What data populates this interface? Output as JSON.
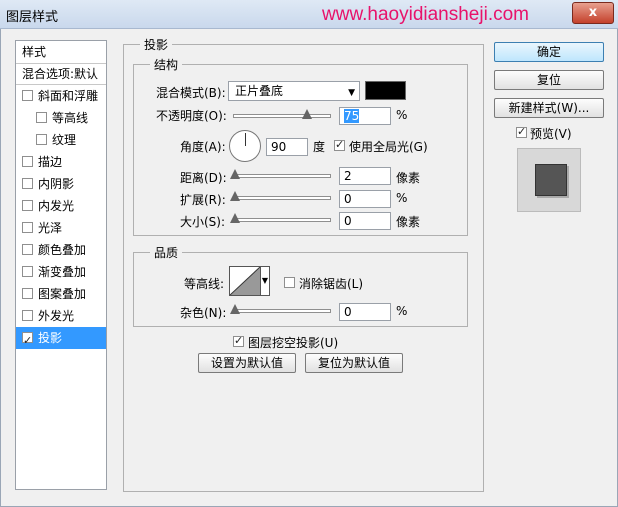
{
  "window": {
    "title": "图层样式",
    "watermark": "www.haoyidiansheji.com",
    "close_label": "x"
  },
  "styles_panel": {
    "header": "样式",
    "blend_options": "混合选项:默认",
    "items": [
      {
        "label": "斜面和浮雕",
        "checked": false,
        "indent": false
      },
      {
        "label": "等高线",
        "checked": false,
        "indent": true
      },
      {
        "label": "纹理",
        "checked": false,
        "indent": true
      },
      {
        "label": "描边",
        "checked": false,
        "indent": false
      },
      {
        "label": "内阴影",
        "checked": false,
        "indent": false
      },
      {
        "label": "内发光",
        "checked": false,
        "indent": false
      },
      {
        "label": "光泽",
        "checked": false,
        "indent": false
      },
      {
        "label": "颜色叠加",
        "checked": false,
        "indent": false
      },
      {
        "label": "渐变叠加",
        "checked": false,
        "indent": false
      },
      {
        "label": "图案叠加",
        "checked": false,
        "indent": false
      },
      {
        "label": "外发光",
        "checked": false,
        "indent": false
      },
      {
        "label": "投影",
        "checked": true,
        "indent": false,
        "selected": true
      }
    ]
  },
  "drop_shadow": {
    "title": "投影",
    "structure": {
      "title": "结构",
      "blend_mode_label": "混合模式(B):",
      "blend_mode_value": "正片叠底",
      "color": "#000000",
      "opacity_label": "不透明度(O):",
      "opacity_value": "75",
      "opacity_unit": "%",
      "angle_label": "角度(A):",
      "angle_value": "90",
      "angle_unit": "度",
      "global_light_label": "使用全局光(G)",
      "global_light_checked": true,
      "distance_label": "距离(D):",
      "distance_value": "2",
      "distance_unit": "像素",
      "spread_label": "扩展(R):",
      "spread_value": "0",
      "spread_unit": "%",
      "size_label": "大小(S):",
      "size_value": "0",
      "size_unit": "像素"
    },
    "quality": {
      "title": "品质",
      "contour_label": "等高线:",
      "antialias_label": "消除锯齿(L)",
      "antialias_checked": false,
      "noise_label": "杂色(N):",
      "noise_value": "0",
      "noise_unit": "%"
    },
    "knockout_label": "图层挖空投影(U)",
    "knockout_checked": true,
    "make_default": "设置为默认值",
    "reset_default": "复位为默认值"
  },
  "buttons": {
    "ok": "确定",
    "reset": "复位",
    "new_style": "新建样式(W)...",
    "preview_label": "预览(V)",
    "preview_checked": true
  },
  "colors": {
    "selection": "#3399ff",
    "watermark": "#e8126a"
  }
}
